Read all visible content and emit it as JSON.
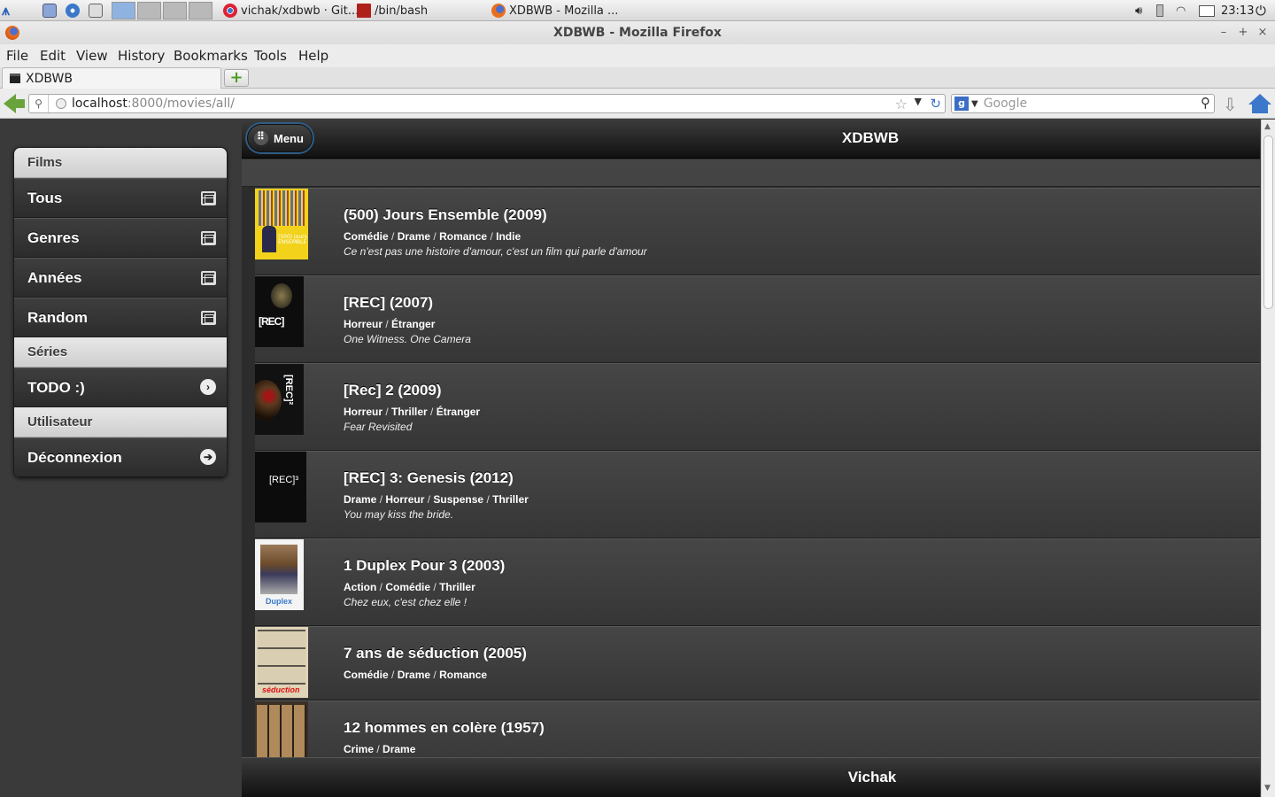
{
  "taskbar": {
    "tasks": [
      {
        "label": "vichak/xdbwb · Git...",
        "icon": "chrome-icon"
      },
      {
        "label": "/bin/bash",
        "icon": "terminal-icon"
      },
      {
        "label": "XDBWB - Mozilla ...",
        "icon": "firefox-icon"
      }
    ],
    "clock": "23:13"
  },
  "window": {
    "title": "XDBWB - Mozilla Firefox",
    "minimize": "–",
    "maximize": "+",
    "close": "×"
  },
  "menubar": [
    "File",
    "Edit",
    "View",
    "History",
    "Bookmarks",
    "Tools",
    "Help"
  ],
  "tab": {
    "label": "XDBWB",
    "new_tab": "+"
  },
  "navbar": {
    "url_host": "localhost",
    "url_path": ":8000/movies/all/",
    "search_placeholder": "Google"
  },
  "sidebar": {
    "films_heading": "Films",
    "films_items": [
      {
        "label": "Tous",
        "icon": "film-icon"
      },
      {
        "label": "Genres",
        "icon": "film-icon"
      },
      {
        "label": "Années",
        "icon": "film-icon"
      },
      {
        "label": "Random",
        "icon": "film-icon"
      }
    ],
    "series_heading": "Séries",
    "series_items": [
      {
        "label": "TODO :)",
        "icon": "chevron-right-icon"
      }
    ],
    "user_heading": "Utilisateur",
    "user_items": [
      {
        "label": "Déconnexion",
        "icon": "logout-icon"
      }
    ]
  },
  "header": {
    "menu_label": "Menu",
    "title": "XDBWB"
  },
  "movies": [
    {
      "title": "(500) Jours Ensemble (2009)",
      "genres": [
        "Comédie",
        "Drame",
        "Romance",
        "Indie"
      ],
      "tagline": "Ce n'est pas une histoire d'amour, c'est un film qui parle d'amour",
      "poster_text": "(500) jours ENSEMBLE"
    },
    {
      "title": "[REC] (2007)",
      "genres": [
        "Horreur",
        "Étranger"
      ],
      "tagline": "One Witness. One Camera",
      "poster_text": "[REC]"
    },
    {
      "title": "[Rec] 2 (2009)",
      "genres": [
        "Horreur",
        "Thriller",
        "Étranger"
      ],
      "tagline": "Fear Revisited",
      "poster_text": "[REC]²"
    },
    {
      "title": "[REC] 3: Genesis (2012)",
      "genres": [
        "Drame",
        "Horreur",
        "Suspense",
        "Thriller"
      ],
      "tagline": "You may kiss the bride.",
      "poster_text": "[REC]³"
    },
    {
      "title": "1 Duplex Pour 3 (2003)",
      "genres": [
        "Action",
        "Comédie",
        "Thriller"
      ],
      "tagline": "Chez eux, c'est chez elle !",
      "poster_text": "Duplex"
    },
    {
      "title": "7 ans de séduction (2005)",
      "genres": [
        "Comédie",
        "Drame",
        "Romance"
      ],
      "tagline": "",
      "poster_text": "séduction"
    },
    {
      "title": "12 hommes en colère (1957)",
      "genres": [
        "Crime",
        "Drame"
      ],
      "tagline": "",
      "poster_text": ""
    }
  ],
  "footer": {
    "label": "Vichak"
  }
}
